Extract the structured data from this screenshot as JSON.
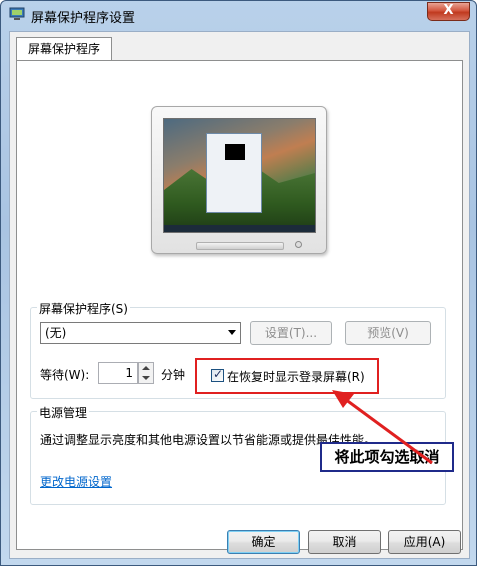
{
  "window": {
    "title": "屏幕保护程序设置",
    "close_label": "X"
  },
  "tab": {
    "label": "屏幕保护程序"
  },
  "screensaver": {
    "group_label": "屏幕保护程序(S)",
    "selected": "(无)",
    "settings_label": "设置(T)...",
    "preview_label": "预览(V)",
    "wait_label": "等待(W):",
    "wait_value": "1",
    "minutes_label": "分钟",
    "resume_checkbox_label": "在恢复时显示登录屏幕(R)",
    "resume_checked": true
  },
  "power": {
    "group_label": "电源管理",
    "description": "通过调整显示亮度和其他电源设置以节省能源或提供最佳性能。",
    "link_label": "更改电源设置"
  },
  "footer": {
    "ok_label": "确定",
    "cancel_label": "取消",
    "apply_label": "应用(A)"
  },
  "annotation": {
    "callout_text": "将此项勾选取消",
    "highlight_color": "#e02020",
    "callout_border_color": "#1f2a8a"
  }
}
